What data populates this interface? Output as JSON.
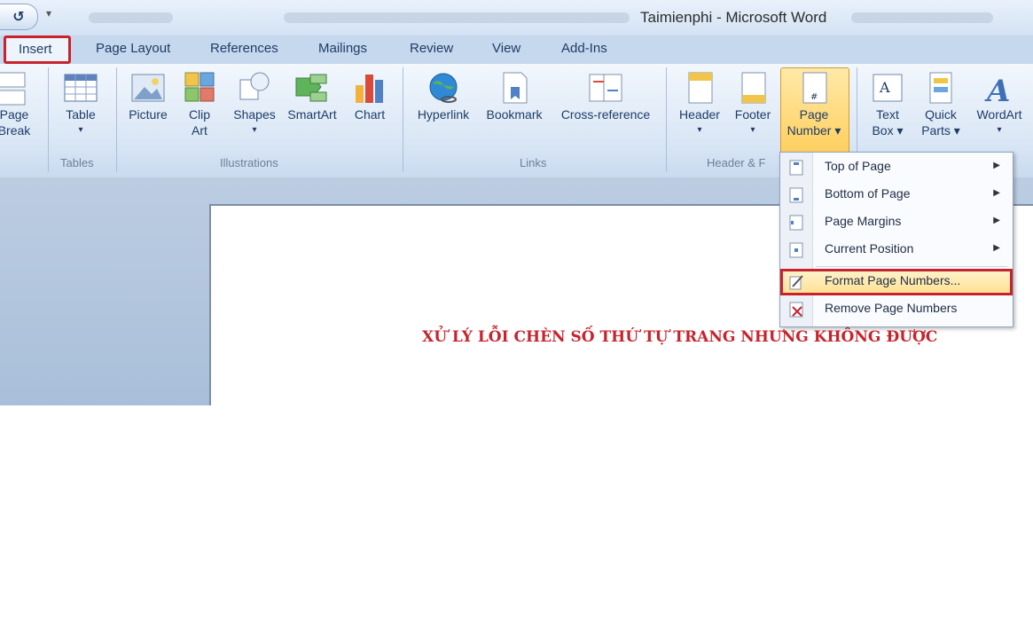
{
  "window": {
    "title": "Taimienphi - Microsoft Word"
  },
  "qat": {
    "undo_glyph": "↺"
  },
  "tabs": [
    {
      "label": "Insert",
      "active": true
    },
    {
      "label": "Page Layout"
    },
    {
      "label": "References"
    },
    {
      "label": "Mailings"
    },
    {
      "label": "Review"
    },
    {
      "label": "View"
    },
    {
      "label": "Add-Ins"
    }
  ],
  "ribbon": {
    "groups": {
      "tables": "Tables",
      "illustrations": "Illustrations",
      "links": "Links",
      "header_footer": "Header & F"
    },
    "buttons": {
      "page_break": [
        "Page",
        "Break"
      ],
      "table": [
        "Table",
        "▾"
      ],
      "picture": "Picture",
      "clip_art": [
        "Clip",
        "Art"
      ],
      "shapes": [
        "Shapes",
        "▾"
      ],
      "smartart": "SmartArt",
      "chart": "Chart",
      "hyperlink": "Hyperlink",
      "bookmark": "Bookmark",
      "cross_reference": "Cross-reference",
      "header": [
        "Header",
        "▾"
      ],
      "footer": [
        "Footer",
        "▾"
      ],
      "page_number": [
        "Page",
        "Number ▾"
      ],
      "text_box": [
        "Text",
        "Box ▾"
      ],
      "quick_parts": [
        "Quick",
        "Parts ▾"
      ],
      "wordart": [
        "WordArt",
        "▾"
      ]
    }
  },
  "page_number_menu": {
    "items": [
      {
        "label": "Top of Page",
        "submenu": true
      },
      {
        "label": "Bottom of Page",
        "submenu": true
      },
      {
        "label": "Page Margins",
        "submenu": true
      },
      {
        "label": "Current Position",
        "submenu": true
      },
      {
        "label": "Format Page Numbers...",
        "highlighted": true
      },
      {
        "label": "Remove Page Numbers"
      }
    ],
    "submenu_arrow": "▶"
  },
  "document": {
    "heading": "XỬ LÝ LỖI CHÈN SỐ THỨ TỰ TRANG NHƯNG KHÔNG ĐƯỢC"
  },
  "colors": {
    "highlight_box": "#c8232c",
    "heading_red": "#c8232c",
    "ribbon_blue": "#dbe7f6"
  }
}
